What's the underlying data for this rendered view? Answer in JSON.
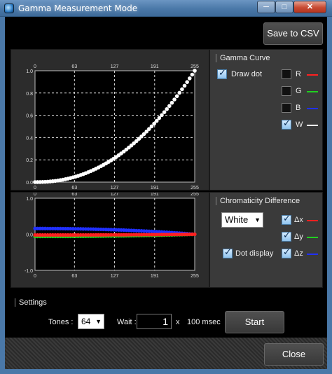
{
  "window": {
    "title": "Gamma Measurement Mode",
    "minimize": "─",
    "maximize": "□",
    "close": "✕"
  },
  "toolbar": {
    "save_csv_label": "Save to CSV"
  },
  "gamma_panel": {
    "group_title": "Gamma Curve",
    "draw_dot": {
      "label": "Draw dot",
      "checked": true
    },
    "channels": [
      {
        "label": "R",
        "checked": false,
        "color": "#ff2020"
      },
      {
        "label": "G",
        "checked": false,
        "color": "#20d020"
      },
      {
        "label": "B",
        "checked": false,
        "color": "#2030ff"
      },
      {
        "label": "W",
        "checked": true,
        "color": "#ffffff"
      }
    ]
  },
  "chroma_panel": {
    "group_title": "Chromaticity Difference",
    "color_select": "White",
    "dot_display": {
      "label": "Dot display",
      "checked": true
    },
    "deltas": [
      {
        "label": "Δx",
        "checked": true,
        "color": "#ff2020"
      },
      {
        "label": "Δy",
        "checked": true,
        "color": "#20d020"
      },
      {
        "label": "Δz",
        "checked": true,
        "color": "#2030ff"
      }
    ]
  },
  "settings": {
    "group_title": "Settings",
    "tones_label": "Tones :",
    "tones_value": "64",
    "wait_label": "Wait :",
    "wait_value": "1",
    "x_label": "x",
    "unit_label": "100 msec",
    "start_label": "Start"
  },
  "footer": {
    "close_label": "Close"
  },
  "chart_data": [
    {
      "type": "scatter",
      "x_ticks": [
        "0",
        "63",
        "127",
        "191",
        "255"
      ],
      "y_ticks": [
        "1.0",
        "0.8",
        "0.6",
        "0.4",
        "0.2",
        "0.0"
      ],
      "xlim": [
        0,
        255
      ],
      "ylim": [
        0,
        1.0
      ],
      "grid": true,
      "series": [
        {
          "color": "#ffffff",
          "gamma": 2.2
        }
      ]
    },
    {
      "type": "scatter",
      "x_ticks": [
        "0",
        "63",
        "127",
        "191",
        "255"
      ],
      "y_ticks": [
        "1.0",
        "0.0",
        "-1.0"
      ],
      "xlim": [
        0,
        255
      ],
      "ylim": [
        -1.0,
        1.0
      ],
      "grid": true,
      "series": [
        {
          "color": "#2030ff",
          "start": 0.16,
          "end": 0.0
        },
        {
          "color": "#20d020",
          "start": -0.06,
          "end": 0.0
        },
        {
          "color": "#ff2020",
          "start": -0.02,
          "end": 0.0
        }
      ]
    }
  ]
}
